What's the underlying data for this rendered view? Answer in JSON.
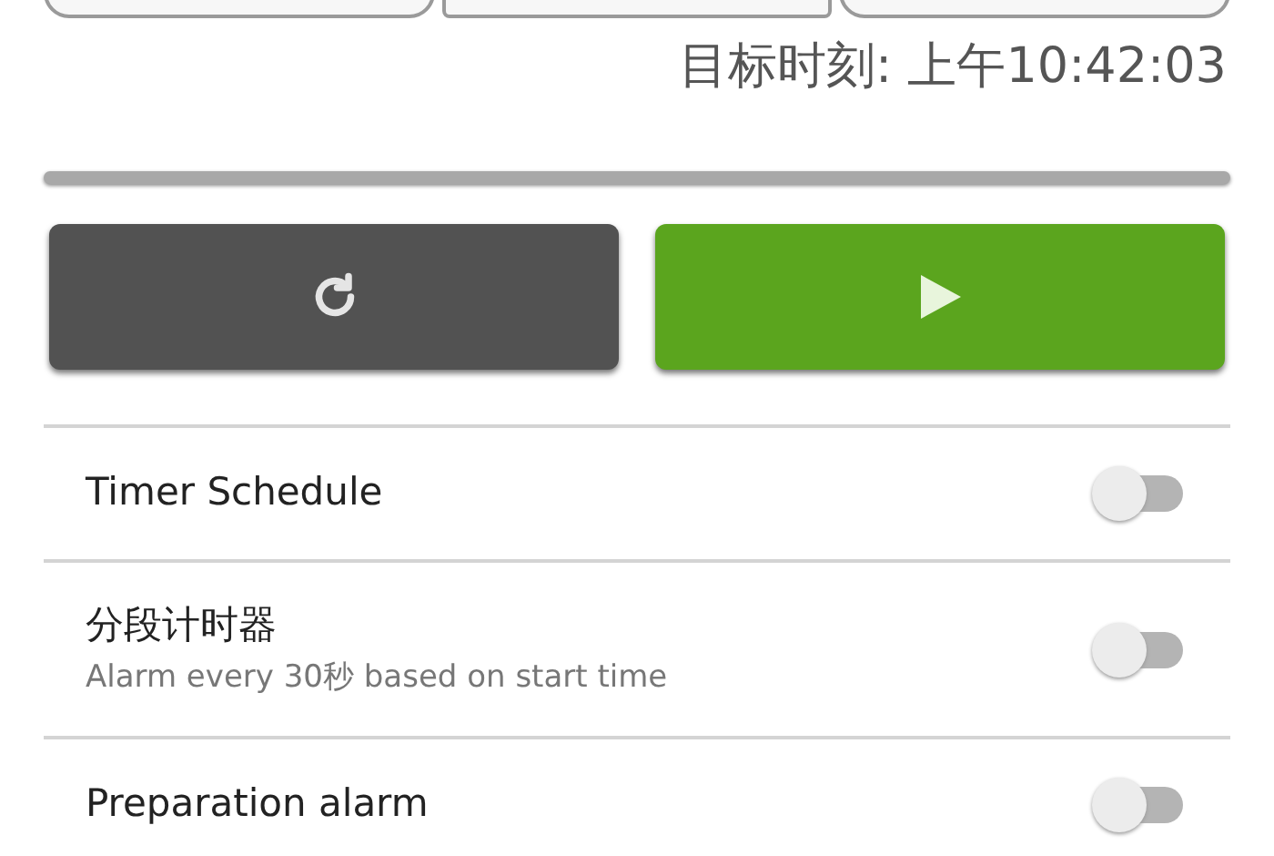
{
  "target_time": "目标时刻: 上午10:42:03",
  "buttons": [
    {
      "kind": "reset"
    },
    {
      "kind": "start"
    }
  ],
  "settings": [
    {
      "title": "Timer Schedule",
      "on": false
    },
    {
      "title": "分段计时器",
      "subtitle": "Alarm every 30秒 based on start time",
      "on": false
    },
    {
      "title": "Preparation alarm",
      "on": false
    }
  ]
}
